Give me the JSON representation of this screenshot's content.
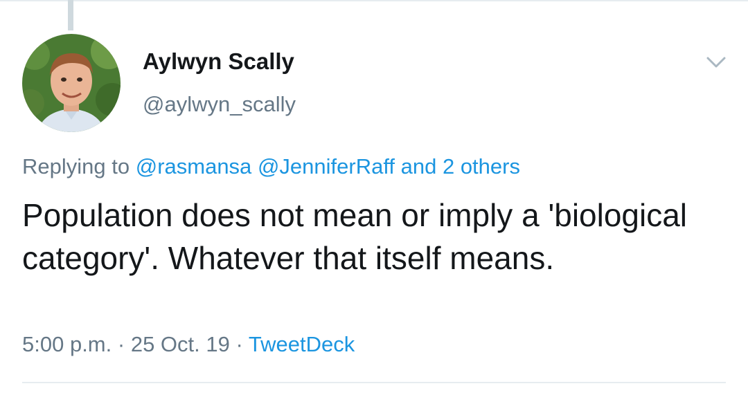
{
  "author": {
    "display_name": "Aylwyn Scally",
    "handle": "@aylwyn_scally"
  },
  "reply_context": {
    "prefix": "Replying to",
    "mentions": [
      "@rasmansa",
      "@JenniferRaff"
    ],
    "others": "and 2 others"
  },
  "tweet": {
    "text": "Population does not mean or imply a 'biological category'. Whatever that itself means."
  },
  "meta": {
    "time": "5:00 p.m.",
    "separator": "·",
    "date": "25 Oct. 19",
    "source": "TweetDeck"
  },
  "icons": {
    "caret": "chevron-down-icon",
    "avatar": "avatar"
  },
  "colors": {
    "link": "#1b95e0",
    "secondary_text": "#657786",
    "primary_text": "#14171a",
    "divider": "#e6ecf0"
  }
}
